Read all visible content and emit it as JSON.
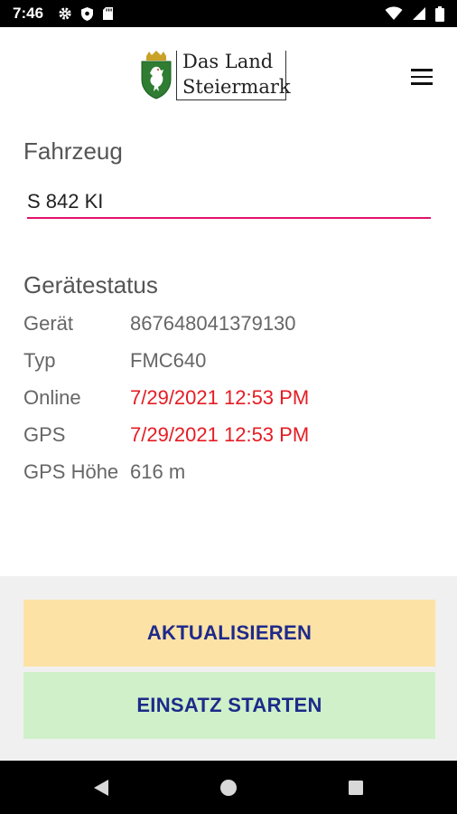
{
  "status_bar": {
    "time": "7:46"
  },
  "header": {
    "logo_line1": "Das Land",
    "logo_line2": "Steiermark",
    "brand_color": "#2e7d32"
  },
  "vehicle": {
    "title": "Fahrzeug",
    "value": "S 842 KI",
    "underline_color": "#e2126a"
  },
  "device_status": {
    "title": "Gerätestatus",
    "rows": [
      {
        "label": "Gerät",
        "value": "867648041379130"
      },
      {
        "label": "Typ",
        "value": "FMC640"
      },
      {
        "label": "Online",
        "value": "7/29/2021 12:53 PM"
      },
      {
        "label": "GPS",
        "value": "7/29/2021 12:53 PM"
      },
      {
        "label": "GPS Höhe",
        "value": "616 m"
      }
    ],
    "alert_color": "#e51c23"
  },
  "actions": {
    "refresh_label": "AKTUALISIEREN",
    "start_label": "EINSATZ STARTEN",
    "refresh_color": "#fde2a6",
    "start_color": "#cff0c9"
  },
  "icons": {
    "status_left": [
      "gear-icon",
      "shield-icon",
      "sd-card-icon"
    ],
    "status_right": [
      "wifi-icon",
      "signal-icon",
      "battery-icon"
    ],
    "nav": [
      "back-icon",
      "home-icon",
      "recents-icon"
    ],
    "menu": "hamburger-menu-icon"
  }
}
